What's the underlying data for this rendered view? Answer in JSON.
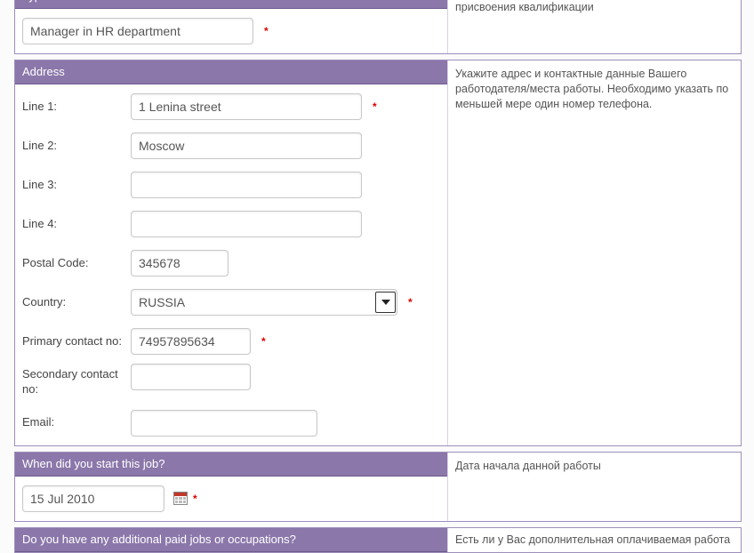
{
  "section_work": {
    "header": "Type of work undertaken",
    "value": "Manager in HR department",
    "hint": "Орган, присваивающий квалификацию, и страна присвоения квалификации"
  },
  "section_address": {
    "header": "Address",
    "hint": "Укажите адрес и контактные данные Вашего работодателя/места работы. Необходимо указать по меньшей мере один номер телефона.",
    "labels": {
      "line1": "Line 1:",
      "line2": "Line 2:",
      "line3": "Line 3:",
      "line4": "Line 4:",
      "postal": "Postal Code:",
      "country": "Country:",
      "primary": "Primary contact no:",
      "secondary": "Secondary contact no:",
      "email": "Email:"
    },
    "values": {
      "line1": "1 Lenina street",
      "line2": "Moscow",
      "line3": "",
      "line4": "",
      "postal": "345678",
      "country": "RUSSIA",
      "primary": "74957895634",
      "secondary": "",
      "email": ""
    }
  },
  "section_start": {
    "header": "When did you start this job?",
    "value": "15 Jul 2010",
    "hint": "Дата начала данной работы"
  },
  "section_additional": {
    "header": "Do you have any additional paid jobs or occupations?",
    "hint": "Есть ли у Вас дополнительная оплачиваемая работа"
  },
  "req": "*"
}
